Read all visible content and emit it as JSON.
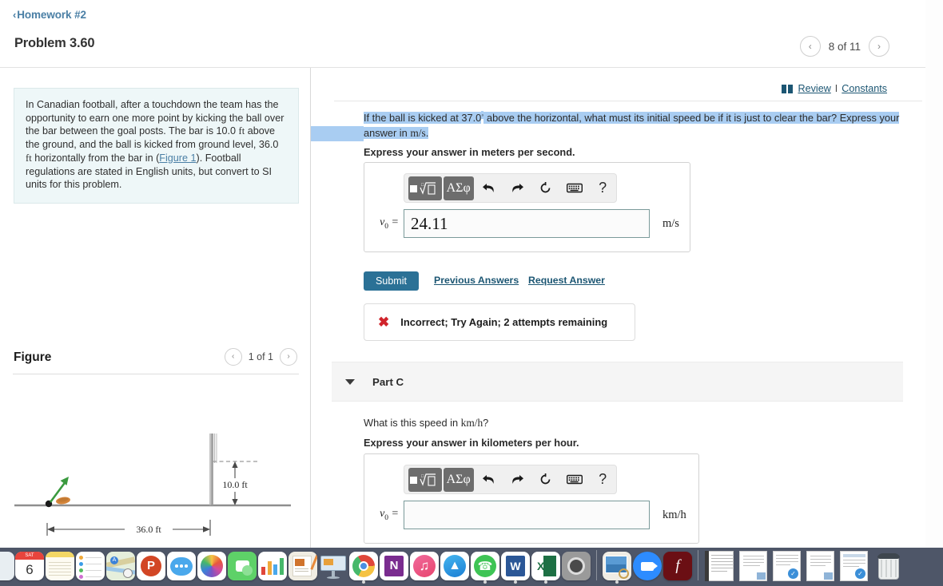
{
  "breadcrumb": {
    "chevron": "‹",
    "label": "Homework #2"
  },
  "header": {
    "problem_title": "Problem 3.60",
    "pager": {
      "prev_icon": "‹",
      "next_icon": "›",
      "count": "8 of 11"
    }
  },
  "left_pane": {
    "statement": {
      "part1": "In Canadian football, after a touchdown the team has the opportunity to earn one more point by kicking the ball over the bar between the goal posts. The bar is 10.0 ",
      "unit1": "ft",
      "part2": " above the ground, and the ball is kicked from ground level, 36.0 ",
      "unit2": "ft",
      "part3": " horizontally from the bar in (",
      "figure_link": "Figure 1",
      "part4": "). Football regulations are stated in English units, but convert to SI units for this problem."
    },
    "figure": {
      "title": "Figure",
      "pager": {
        "prev_icon": "‹",
        "next_icon": "›",
        "count": "1 of 1"
      },
      "height_label": "10.0 ft",
      "distance_label": "36.0 ft",
      "arrow_color": "#3a9a3f",
      "ball_color": "#d4853a",
      "ground_color": "#8a8a8a"
    }
  },
  "right_pane": {
    "review": {
      "review_label": "Review",
      "separator": "I",
      "constants_label": "Constants"
    },
    "question": {
      "pre": "If the ball is kicked at 37.0",
      "degree": "◦",
      "mid": " above the horizontal, what must its initial speed be if it is just to clear the bar? Express your answer in ",
      "unit": "m/s",
      "end": ".",
      "highlight_color": "#a9cdf2"
    },
    "part_b": {
      "express_label": "Express your answer in meters per second.",
      "toolbar": {
        "template_icon": "math-template",
        "greek_label": "ΑΣφ",
        "undo_icon": "↩",
        "redo_icon": "↪",
        "reset_icon": "↻",
        "keyboard_icon": "keyboard",
        "help_icon": "?"
      },
      "var_label": "v",
      "var_sub": "0",
      "equals": "=",
      "value": "24.11",
      "placeholder": "",
      "units": "m/s"
    },
    "actions": {
      "submit_label": "Submit",
      "previous_answers_label": "Previous Answers",
      "request_answer_label": "Request Answer"
    },
    "feedback": {
      "icon": "✖",
      "icon_color": "#d0232b",
      "text": "Incorrect; Try Again; 2 attempts remaining"
    },
    "part_c": {
      "caret": "▼",
      "label": "Part C",
      "question_pre": "What is this speed in ",
      "question_unit": "km/h",
      "question_end": "?",
      "express_label": "Express your answer in kilometers per hour.",
      "toolbar": {
        "template_icon": "math-template",
        "greek_label": "ΑΣφ",
        "undo_icon": "↩",
        "redo_icon": "↪",
        "reset_icon": "↻",
        "keyboard_icon": "keyboard",
        "help_icon": "?"
      },
      "var_label": "v",
      "var_sub": "0",
      "equals": "=",
      "value": "",
      "placeholder": "",
      "units": "km/h"
    }
  },
  "dock": {
    "background": "#4e5668",
    "items": [
      {
        "name": "finder-icon",
        "label": "Finder",
        "running": false
      },
      {
        "name": "calendar-icon",
        "label": "Calendar",
        "day": "6",
        "month": "SAT",
        "running": false
      },
      {
        "name": "notes-icon",
        "label": "Notes",
        "running": false
      },
      {
        "name": "reminders-icon",
        "label": "Reminders",
        "running": false
      },
      {
        "name": "maps-icon",
        "label": "Maps",
        "running": false
      },
      {
        "name": "powerpoint-icon",
        "label": "PowerPoint",
        "running": false
      },
      {
        "name": "messages-icon",
        "label": "Messages",
        "running": false
      },
      {
        "name": "photos-icon",
        "label": "Photos",
        "running": false
      },
      {
        "name": "facetime-icon",
        "label": "FaceTime",
        "running": false
      },
      {
        "name": "numbers-icon",
        "label": "Numbers",
        "running": false
      },
      {
        "name": "pages-icon",
        "label": "Pages",
        "running": false
      },
      {
        "name": "keynote-icon",
        "label": "Keynote",
        "running": false
      },
      {
        "name": "chrome-icon",
        "label": "Google Chrome",
        "running": true
      },
      {
        "name": "onenote-icon",
        "label": "OneNote",
        "running": false
      },
      {
        "name": "music-icon",
        "label": "iTunes",
        "running": false
      },
      {
        "name": "app-store-icon",
        "label": "App Store",
        "running": false
      },
      {
        "name": "whatsapp-icon",
        "label": "WhatsApp",
        "running": true
      },
      {
        "name": "word-icon",
        "label": "Microsoft Word",
        "running": true
      },
      {
        "name": "excel-icon",
        "label": "Microsoft Excel",
        "running": true
      },
      {
        "name": "system-preferences-icon",
        "label": "System Preferences",
        "running": false
      }
    ],
    "items2": [
      {
        "name": "preview-icon",
        "label": "Preview",
        "running": true
      },
      {
        "name": "zoom-icon",
        "label": "Zoom",
        "running": false
      },
      {
        "name": "flash-player-icon",
        "label": "Flash Player",
        "running": false
      }
    ],
    "documents": [
      {
        "name": "notebook-doc-icon",
        "label": "Notebook"
      },
      {
        "name": "text-doc-icon",
        "label": "Document"
      },
      {
        "name": "spreadsheet-doc-icon",
        "label": "Spreadsheet"
      },
      {
        "name": "text-doc-icon-2",
        "label": "Document"
      },
      {
        "name": "report-doc-icon",
        "label": "Report"
      }
    ],
    "trash": {
      "name": "trash-icon",
      "label": "Trash"
    }
  }
}
